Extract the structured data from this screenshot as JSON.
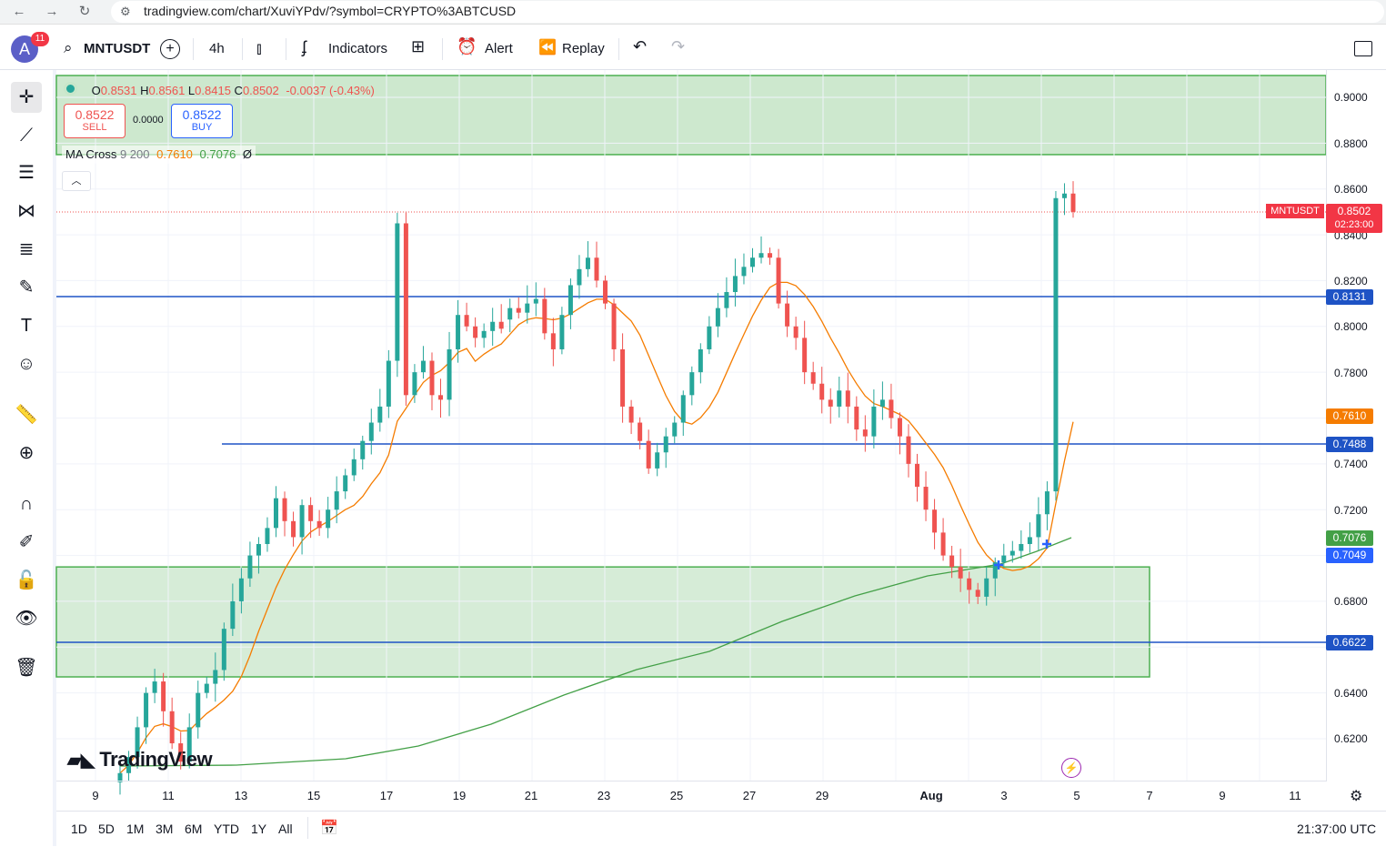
{
  "browser": {
    "url": "tradingview.com/chart/XuviYPdv/?symbol=CRYPTO%3ABTCUSD"
  },
  "toolbar": {
    "avatar_letter": "A",
    "notif_count": "11",
    "symbol": "MNTUSDT",
    "interval": "4h",
    "indicators_label": "Indicators",
    "alert_label": "Alert",
    "replay_label": "Replay"
  },
  "legend": {
    "open_label": "O",
    "open": "0.8531",
    "high_label": "H",
    "high": "0.8561",
    "low_label": "L",
    "low": "0.8415",
    "close_label": "C",
    "close": "0.8502",
    "change": "-0.0037 (-0.43%)",
    "sell_price": "0.8522",
    "sell_label": "SELL",
    "spread": "0.0000",
    "buy_price": "0.8522",
    "buy_label": "BUY",
    "ma_name": "MA Cross",
    "ma_params": "9 200",
    "ma_fast": "0.7610",
    "ma_slow": "0.7076",
    "ma_extra": "Ø"
  },
  "price_axis": {
    "ticks": [
      "0.9000",
      "0.8800",
      "0.8600",
      "0.8400",
      "0.8200",
      "0.8000",
      "0.7800",
      "0.7400",
      "0.7200",
      "0.6800",
      "0.6400",
      "0.6200"
    ],
    "symbol_tag": "MNTUSDT",
    "last_price": "0.8502",
    "countdown": "02:23:00",
    "level_1": "0.8131",
    "ma_fast_label": "0.7610",
    "level_2": "0.7488",
    "ma_slow_label": "0.7076",
    "cross_label": "0.7049",
    "level_3": "0.6622"
  },
  "time_axis": {
    "ticks": [
      "9",
      "11",
      "13",
      "15",
      "17",
      "19",
      "21",
      "23",
      "25",
      "27",
      "29",
      "Aug",
      "3",
      "5",
      "7",
      "9",
      "11"
    ]
  },
  "bottom_bar": {
    "ranges": [
      "1D",
      "5D",
      "1M",
      "3M",
      "6M",
      "YTD",
      "1Y",
      "All"
    ],
    "clock": "21:37:00 UTC"
  },
  "logo_text": "TradingView",
  "colors": {
    "up": "#26a69a",
    "down": "#ef5350",
    "ma_fast": "#f57c00",
    "ma_slow": "#43a047",
    "level_line": "#1e53c5",
    "zone_fill": "#c8e6c9",
    "zone_border": "#4caf50"
  },
  "chart_data": {
    "type": "candlestick",
    "ylim": [
      0.605,
      0.91
    ],
    "x_ticks": [
      "9",
      "11",
      "13",
      "15",
      "17",
      "19",
      "21",
      "23",
      "25",
      "27",
      "29",
      "Aug",
      "3",
      "5",
      "7",
      "9",
      "11"
    ],
    "horizontal_levels": [
      0.8131,
      0.7488,
      0.6622
    ],
    "zones": [
      [
        0.875,
        0.91
      ],
      [
        0.647,
        0.695
      ]
    ],
    "ma_fast_last": 0.761,
    "ma_slow_last": 0.7076,
    "series": [
      {
        "name": "MNTUSDT",
        "close": [
          0.605,
          0.612,
          0.625,
          0.64,
          0.645,
          0.632,
          0.618,
          0.61,
          0.625,
          0.64,
          0.644,
          0.65,
          0.668,
          0.68,
          0.69,
          0.7,
          0.705,
          0.712,
          0.725,
          0.715,
          0.708,
          0.722,
          0.715,
          0.712,
          0.72,
          0.728,
          0.735,
          0.742,
          0.75,
          0.758,
          0.765,
          0.785,
          0.845,
          0.77,
          0.78,
          0.785,
          0.77,
          0.768,
          0.79,
          0.805,
          0.8,
          0.795,
          0.798,
          0.802,
          0.803,
          0.808,
          0.806,
          0.81,
          0.812,
          0.797,
          0.79,
          0.805,
          0.818,
          0.825,
          0.83,
          0.82,
          0.81,
          0.79,
          0.765,
          0.758,
          0.75,
          0.738,
          0.745,
          0.752,
          0.758,
          0.77,
          0.78,
          0.79,
          0.8,
          0.808,
          0.815,
          0.822,
          0.826,
          0.83,
          0.832,
          0.83,
          0.81,
          0.8,
          0.795,
          0.78,
          0.775,
          0.768,
          0.765,
          0.772,
          0.765,
          0.755,
          0.752,
          0.765,
          0.768,
          0.76,
          0.752,
          0.74,
          0.73,
          0.72,
          0.71,
          0.7,
          0.695,
          0.69,
          0.685,
          0.682,
          0.69,
          0.697,
          0.7,
          0.702,
          0.705,
          0.708,
          0.718,
          0.728,
          0.856,
          0.858,
          0.85
        ]
      }
    ]
  }
}
